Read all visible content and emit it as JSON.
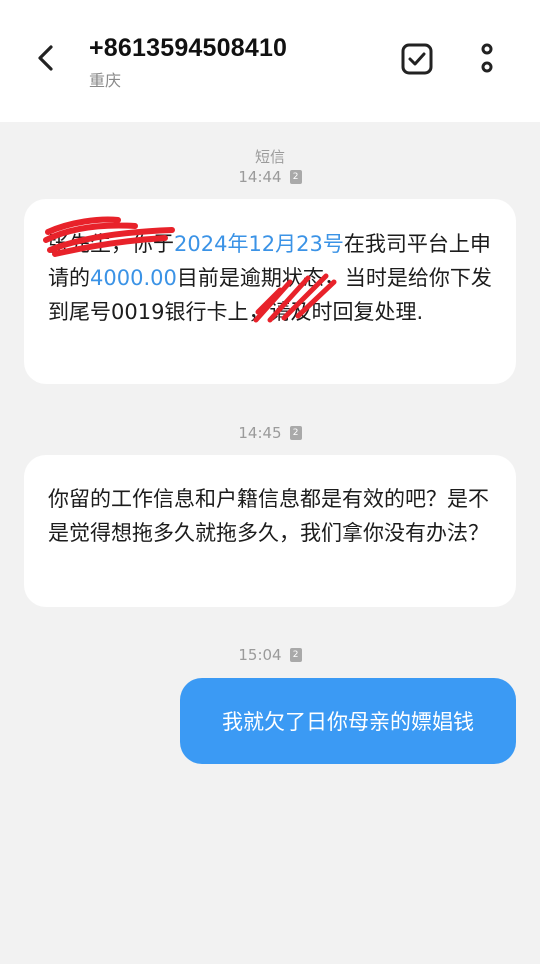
{
  "header": {
    "title": "+8613594508410",
    "subtitle": "重庆",
    "icons": {
      "back": "back-arrow-icon",
      "check": "checkbox-icon",
      "more": "more-vertical-icon"
    }
  },
  "thread": {
    "channel_label": "短信",
    "sim_label": "2",
    "messages": [
      {
        "direction": "incoming",
        "time": "14:44",
        "parts": [
          {
            "text": "张先生，你于",
            "link": false
          },
          {
            "text": "2024年12月23号",
            "link": true
          },
          {
            "text": "在我司平台上申请的",
            "link": false
          },
          {
            "text": "4000.00",
            "link": true
          },
          {
            "text": "目前是逾期状态，当时是给你下发到尾号0019银行卡上，请及时回复处理.",
            "link": false
          }
        ],
        "redacted": true
      },
      {
        "direction": "incoming",
        "time": "14:45",
        "text": "你留的工作信息和户籍信息都是有效的吧？是不是觉得想拖多久就拖多久，我们拿你没有办法？"
      },
      {
        "direction": "outgoing",
        "time": "15:04",
        "text": "我就欠了日你母亲的嫖娼钱"
      }
    ]
  },
  "colors": {
    "background": "#f2f2f2",
    "header_bg": "#ffffff",
    "incoming_bubble": "#ffffff",
    "outgoing_bubble": "#3b9af4",
    "link": "#3b93e6",
    "redaction": "#e8222a"
  }
}
